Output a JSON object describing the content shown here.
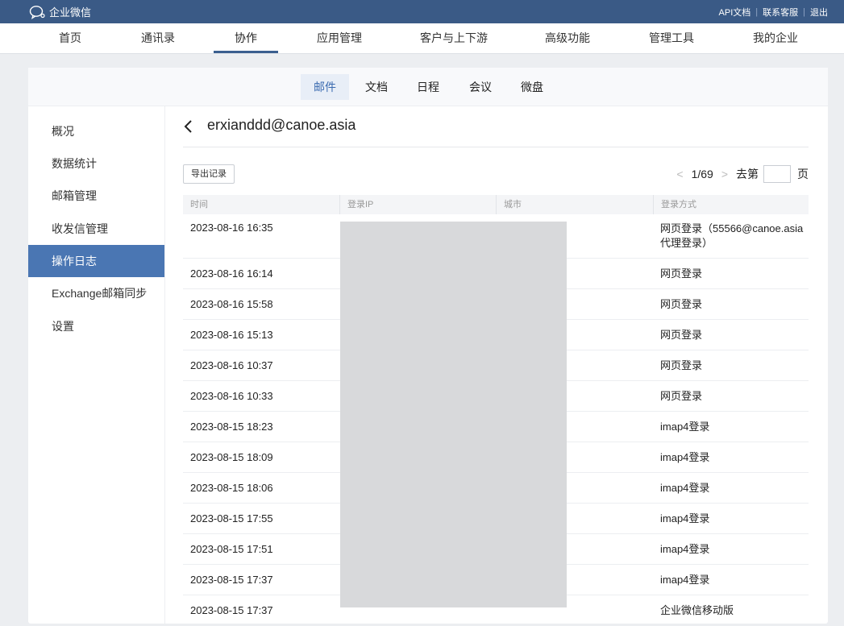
{
  "topbar": {
    "brand": "企业微信",
    "links": [
      "API文档",
      "联系客服",
      "退出"
    ]
  },
  "mainnav": {
    "items": [
      "首页",
      "通讯录",
      "协作",
      "应用管理",
      "客户与上下游",
      "高级功能",
      "管理工具",
      "我的企业"
    ],
    "active_index": 2
  },
  "subtabs": {
    "items": [
      "邮件",
      "文档",
      "日程",
      "会议",
      "微盘"
    ],
    "active_index": 0
  },
  "sidebar": {
    "items": [
      "概况",
      "数据统计",
      "邮箱管理",
      "收发信管理",
      "操作日志",
      "Exchange邮箱同步",
      "设置"
    ],
    "active_index": 4
  },
  "header": {
    "email": "erxianddd@canoe.asia"
  },
  "toolbar": {
    "export_label": "导出记录"
  },
  "pager": {
    "current": "1/69",
    "goto_label": "去第",
    "page_label": "页",
    "goto_value": ""
  },
  "table": {
    "columns": [
      "时间",
      "登录IP",
      "城市",
      "登录方式"
    ],
    "rows": [
      {
        "time": "2023-08-16 16:35",
        "method": "网页登录（55566@canoe.asia代理登录）"
      },
      {
        "time": "2023-08-16 16:14",
        "method": "网页登录"
      },
      {
        "time": "2023-08-16 15:58",
        "method": "网页登录"
      },
      {
        "time": "2023-08-16 15:13",
        "method": "网页登录"
      },
      {
        "time": "2023-08-16 10:37",
        "method": "网页登录"
      },
      {
        "time": "2023-08-16 10:33",
        "method": "网页登录"
      },
      {
        "time": "2023-08-15 18:23",
        "method": "imap4登录"
      },
      {
        "time": "2023-08-15 18:09",
        "method": "imap4登录"
      },
      {
        "time": "2023-08-15 18:06",
        "method": "imap4登录"
      },
      {
        "time": "2023-08-15 17:55",
        "method": "imap4登录"
      },
      {
        "time": "2023-08-15 17:51",
        "method": "imap4登录"
      },
      {
        "time": "2023-08-15 17:37",
        "method": "imap4登录"
      },
      {
        "time": "2023-08-15 17:37",
        "method": "企业微信移动版"
      }
    ]
  },
  "colors": {
    "topbar": "#3a5a86",
    "sidebar_active": "#4a76b3",
    "subtab_active_text": "#3b6bb0",
    "redaction": "#d8d9db"
  }
}
